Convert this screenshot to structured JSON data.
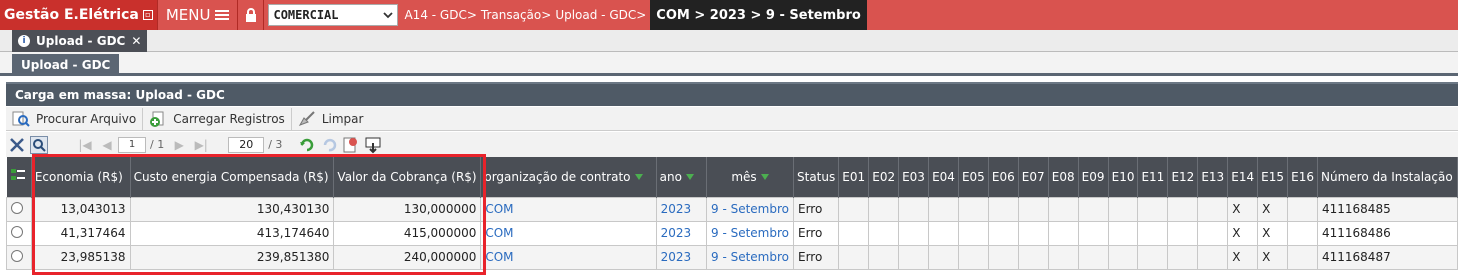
{
  "topbar": {
    "app_title": "Gestão E.Elétrica",
    "menu_label": "MENU",
    "select_value": "COMERCIAL",
    "breadcrumb": [
      "A14 - GDC>",
      "Transação>",
      "Upload - GDC>"
    ],
    "breadcrumb_current": "COM > 2023 > 9 - Setembro"
  },
  "tab": {
    "label": "Upload - GDC"
  },
  "subtab": {
    "label": "Upload - GDC"
  },
  "panel": {
    "title": "Carga em massa: Upload - GDC"
  },
  "toolbar": {
    "browse_label": "Procurar Arquivo",
    "load_label": "Carregar Registros",
    "clear_label": "Limpar"
  },
  "pager": {
    "page": "1",
    "page_total": "/ 1",
    "page_size": "20",
    "size_total": "/ 3"
  },
  "colors": {
    "topbar": "#d9534f",
    "header": "#4a4e55",
    "highlight": "#e8232b",
    "link": "#2a6bbf"
  },
  "table": {
    "headers": [
      "Economia (R$)",
      "Custo energia Compensada (R$)",
      "Valor da Cobrança (R$)",
      "organização de contrato",
      "ano",
      "mês",
      "Status",
      "E01",
      "E02",
      "E03",
      "E04",
      "E05",
      "E06",
      "E07",
      "E08",
      "E09",
      "E10",
      "E11",
      "E12",
      "E13",
      "E14",
      "E15",
      "E16",
      "Número da Instalação"
    ],
    "rows": [
      [
        "13,043013",
        "130,430130",
        "130,000000",
        "COM",
        "2023",
        "9 - Setembro",
        "Erro",
        "",
        "",
        "",
        "",
        "",
        "",
        "",
        "",
        "",
        "",
        "",
        "",
        "",
        "X",
        "X",
        "",
        "411168485"
      ],
      [
        "41,317464",
        "413,174640",
        "415,000000",
        "COM",
        "2023",
        "9 - Setembro",
        "Erro",
        "",
        "",
        "",
        "",
        "",
        "",
        "",
        "",
        "",
        "",
        "",
        "",
        "",
        "X",
        "X",
        "",
        "411168486"
      ],
      [
        "23,985138",
        "239,851380",
        "240,000000",
        "COM",
        "2023",
        "9 - Setembro",
        "Erro",
        "",
        "",
        "",
        "",
        "",
        "",
        "",
        "",
        "",
        "",
        "",
        "",
        "",
        "X",
        "X",
        "",
        "411168487"
      ]
    ]
  }
}
